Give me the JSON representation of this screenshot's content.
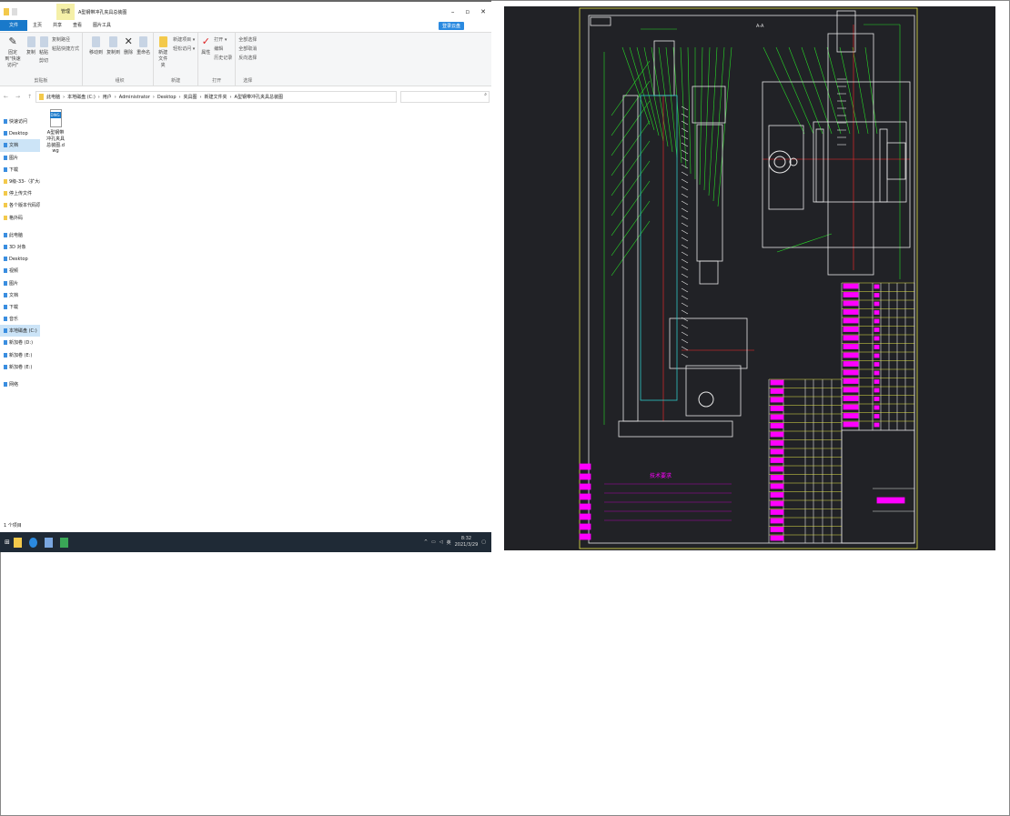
{
  "explorer": {
    "title": "A型钢带冲孔夹具总装图",
    "context_tab": "管理",
    "tabs": [
      "文件",
      "主页",
      "共享",
      "查看",
      "图片工具"
    ],
    "share_button": "登录云盘",
    "ribbon": {
      "clipboard": {
        "label": "剪贴板",
        "pin": "固定到\"快速访问\"",
        "copy": "复制",
        "paste": "粘贴",
        "copy_path": "复制路径",
        "paste_shortcut": "粘贴快捷方式",
        "cut": "剪切"
      },
      "organize": {
        "label": "组织",
        "move_to": "移动到",
        "copy_to": "复制到",
        "delete": "删除",
        "rename": "重命名"
      },
      "new": {
        "label": "新建",
        "new_folder": "新建文件夹",
        "new_item": "新建项目 ▾",
        "easy_access": "轻松访问 ▾"
      },
      "open": {
        "label": "打开",
        "properties": "属性",
        "open": "打开 ▾",
        "edit": "编辑",
        "history": "历史记录"
      },
      "select": {
        "label": "选择",
        "select_all": "全部选择",
        "select_none": "全部取消",
        "invert": "反向选择"
      }
    },
    "breadcrumb": [
      "此电脑",
      "本地磁盘 (C:)",
      "用户",
      "Administrator",
      "Desktop",
      "夹具图",
      "新建文件夹",
      "A型钢带冲孔夹具总装图"
    ],
    "sidebar": [
      {
        "label": "快速访问",
        "icon": "star-icon"
      },
      {
        "label": "Desktop",
        "icon": "desktop-icon"
      },
      {
        "label": "文档",
        "icon": "document-icon",
        "selected": true
      },
      {
        "label": "图片",
        "icon": "picture-icon"
      },
      {
        "label": "下载",
        "icon": "download-icon"
      },
      {
        "label": "9级-33-（扩大出门",
        "icon": "folder-icon"
      },
      {
        "label": "停上传文件",
        "icon": "folder-icon"
      },
      {
        "label": "各个版本代码原后",
        "icon": "folder-icon"
      },
      {
        "label": "格外码",
        "icon": "folder-icon"
      },
      {
        "label": "此电脑",
        "icon": "computer-icon"
      },
      {
        "label": "3D 对象",
        "icon": "cube-icon"
      },
      {
        "label": "Desktop",
        "icon": "desktop-icon"
      },
      {
        "label": "视频",
        "icon": "video-icon"
      },
      {
        "label": "图片",
        "icon": "picture-icon"
      },
      {
        "label": "文档",
        "icon": "document-icon"
      },
      {
        "label": "下载",
        "icon": "download-icon"
      },
      {
        "label": "音乐",
        "icon": "music-icon"
      },
      {
        "label": "本地磁盘 (C:)",
        "icon": "drive-icon",
        "selected": true
      },
      {
        "label": "新加卷 (D:)",
        "icon": "drive-icon"
      },
      {
        "label": "新加卷 (E:)",
        "icon": "drive-icon"
      },
      {
        "label": "新加卷 (E:)",
        "icon": "drive-icon"
      },
      {
        "label": "网络",
        "icon": "network-icon"
      }
    ],
    "file": {
      "name": "A型钢带冲孔夹具总装图.dwg"
    },
    "status": "1 个项目",
    "taskbar": {
      "time": "8:32",
      "date": "2021/3/29",
      "ime": "英"
    }
  },
  "cad": {
    "view_label": "A-A",
    "tech_title": "技术要求",
    "colors": {
      "bg": "#212226",
      "frame": "#e6e64a",
      "line": "#e8e8e8",
      "leader": "#27d927",
      "dim": "#ff00ff",
      "center": "#ff2a2a",
      "cyan": "#2ec7c7"
    }
  }
}
